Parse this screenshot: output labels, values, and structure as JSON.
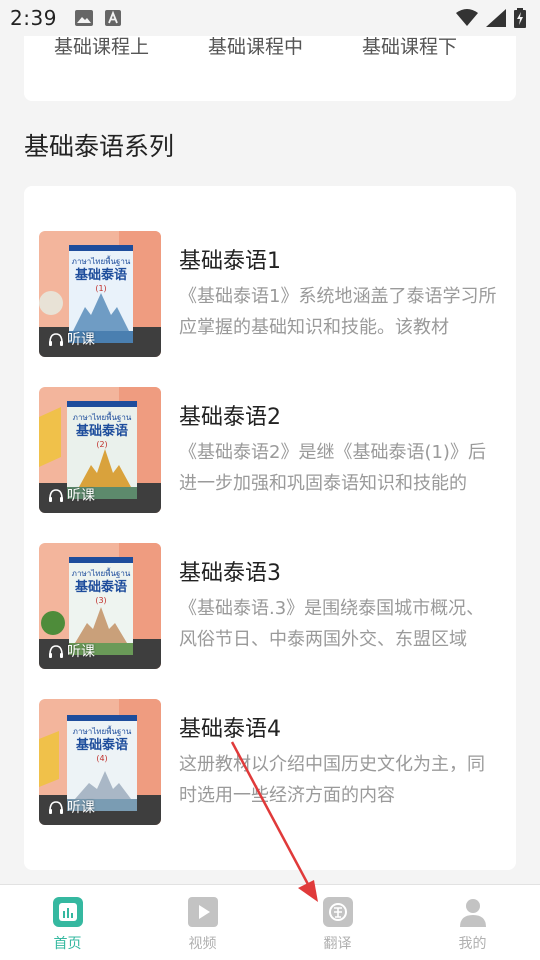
{
  "status_bar": {
    "time": "2:39",
    "icons_left": [
      "image-icon",
      "text-notification-icon"
    ],
    "icons_right": [
      "wifi-icon",
      "cellular-signal-icon",
      "battery-charging-icon"
    ]
  },
  "previous_card": {
    "tabs": [
      {
        "label": "基础课程上"
      },
      {
        "label": "基础课程中"
      },
      {
        "label": "基础课程下"
      }
    ]
  },
  "section": {
    "title": "基础泰语系列"
  },
  "books": [
    {
      "title": "基础泰语1",
      "description": "《基础泰语1》系统地涵盖了泰语学习所应掌握的基础知识和技能。该教材",
      "listen_label": "听课",
      "cover_volume": "(1)",
      "cover_title": "基础泰语",
      "cover_thai": "ภาษาไทยพื้นฐาน"
    },
    {
      "title": "基础泰语2",
      "description": "《基础泰语2》是继《基础泰语(1)》后进一步加强和巩固泰语知识和技能的",
      "listen_label": "听课",
      "cover_volume": "(2)",
      "cover_title": "基础泰语",
      "cover_thai": "ภาษาไทยพื้นฐาน"
    },
    {
      "title": "基础泰语3",
      "description": "《基础泰语.3》是围绕泰国城市概况、风俗节日、中泰两国外交、东盟区域",
      "listen_label": "听课",
      "cover_volume": "(3)",
      "cover_title": "基础泰语",
      "cover_thai": "ภาษาไทยพื้นฐาน"
    },
    {
      "title": "基础泰语4",
      "description": "这册教材以介绍中国历史文化为主，同时选用一些经济方面的内容",
      "listen_label": "听课",
      "cover_volume": "(4)",
      "cover_title": "基础泰语",
      "cover_thai": "ภาษาไทยพื้นฐาน"
    }
  ],
  "bottom_nav": {
    "items": [
      {
        "label": "首页",
        "icon": "home-chart-icon",
        "active": true
      },
      {
        "label": "视频",
        "icon": "video-play-icon",
        "active": false
      },
      {
        "label": "翻译",
        "icon": "translate-icon",
        "active": false
      },
      {
        "label": "我的",
        "icon": "profile-icon",
        "active": false
      }
    ]
  },
  "colors": {
    "accent": "#35b8a0",
    "annotation_arrow": "#e03a3a",
    "inactive_nav": "#b0b0b0",
    "description_text": "#9a9a9a"
  }
}
